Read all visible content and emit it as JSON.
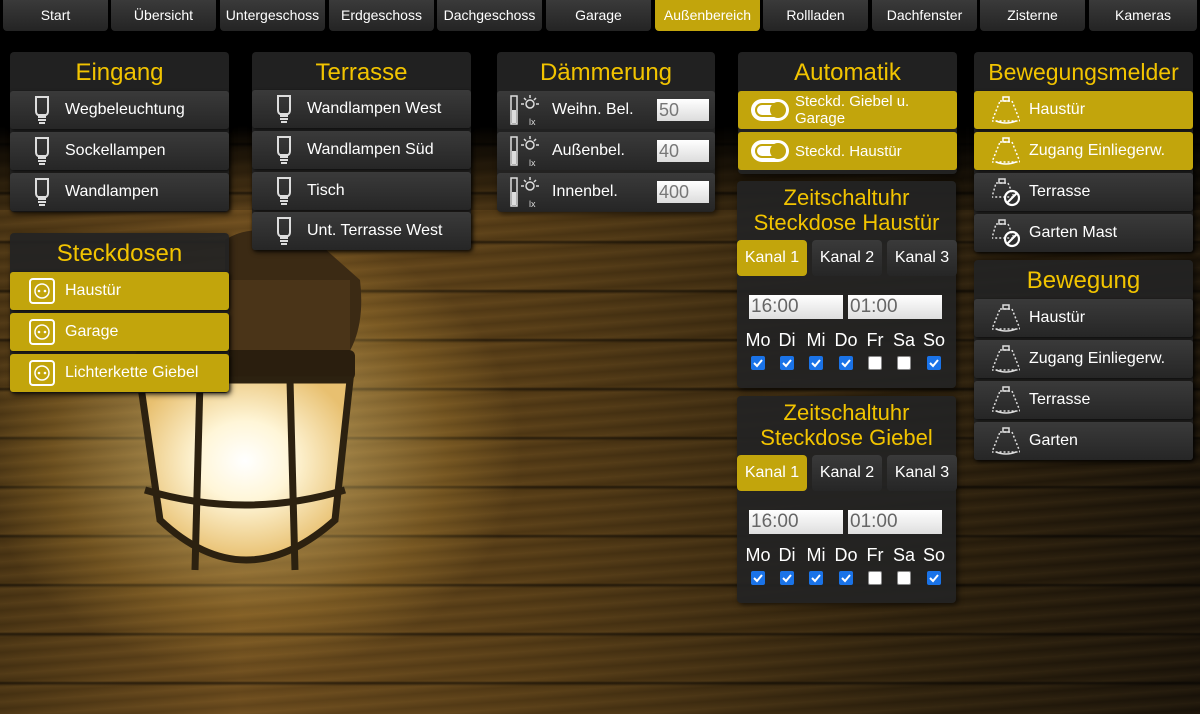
{
  "nav": {
    "tabs": [
      "Start",
      "Übersicht",
      "Untergeschoss",
      "Erdgeschoss",
      "Dachgeschoss",
      "Garage",
      "Außenbereich",
      "Rollladen",
      "Dachfenster",
      "Zisterne",
      "Kameras"
    ],
    "active_index": 6
  },
  "eingang": {
    "title": "Eingang",
    "items": [
      "Wegbeleuchtung",
      "Sockellampen",
      "Wandlampen"
    ]
  },
  "steckdosen": {
    "title": "Steckdosen",
    "items": [
      "Haustür",
      "Garage",
      "Lichterkette Giebel"
    ]
  },
  "terrasse": {
    "title": "Terrasse",
    "items": [
      "Wandlampen West",
      "Wandlampen Süd",
      "Tisch",
      "Unt. Terrasse West"
    ]
  },
  "daemmerung": {
    "title": "Dämmerung",
    "items": [
      {
        "label": "Weihn. Bel.",
        "value": "50"
      },
      {
        "label": "Außenbel.",
        "value": "40"
      },
      {
        "label": "Innenbel.",
        "value": "400"
      }
    ],
    "unit_icon_text": "lx"
  },
  "automatik": {
    "title": "Automatik",
    "items": [
      "Steckd. Giebel u. Garage",
      "Steckd. Haustür"
    ]
  },
  "timers": [
    {
      "title_line1": "Zeitschaltuhr",
      "title_line2": "Steckdose Haustür",
      "channels": [
        "Kanal 1",
        "Kanal 2",
        "Kanal 3"
      ],
      "active_channel": 0,
      "on_time": "16:00",
      "off_time": "01:00",
      "days": [
        "Mo",
        "Di",
        "Mi",
        "Do",
        "Fr",
        "Sa",
        "So"
      ],
      "checked": [
        true,
        true,
        true,
        true,
        false,
        false,
        true
      ]
    },
    {
      "title_line1": "Zeitschaltuhr",
      "title_line2": "Steckdose Giebel",
      "channels": [
        "Kanal 1",
        "Kanal 2",
        "Kanal 3"
      ],
      "active_channel": 0,
      "on_time": "16:00",
      "off_time": "01:00",
      "days": [
        "Mo",
        "Di",
        "Mi",
        "Do",
        "Fr",
        "Sa",
        "So"
      ],
      "checked": [
        true,
        true,
        true,
        true,
        false,
        false,
        true
      ]
    }
  ],
  "bewegungsmelder": {
    "title": "Bewegungsmelder",
    "items": [
      {
        "label": "Haustür",
        "state": "active"
      },
      {
        "label": "Zugang Einliegerw.",
        "state": "active"
      },
      {
        "label": "Terrasse",
        "state": "disabled"
      },
      {
        "label": "Garten Mast",
        "state": "disabled"
      }
    ]
  },
  "bewegung": {
    "title": "Bewegung",
    "items": [
      "Haustür",
      "Zugang Einliegerw.",
      "Terrasse",
      "Garten"
    ]
  },
  "colors": {
    "accent": "#c2a50c",
    "title": "#f2c400",
    "panel": "#232323"
  },
  "icons": {
    "lamp": "light-bulb-icon",
    "socket": "power-socket-icon",
    "sensor": "motion-sensor-icon",
    "dusk": "dusk-sensor-icon",
    "toggle": "toggle-switch-icon"
  }
}
